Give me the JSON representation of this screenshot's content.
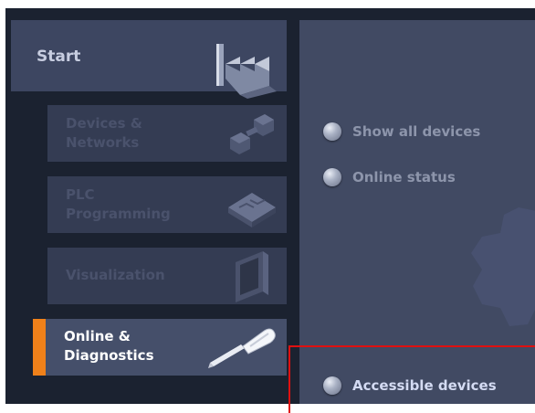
{
  "nav": {
    "start": {
      "label": "Start",
      "icon": "factory-icon"
    },
    "items": [
      {
        "label": "Devices &\nNetworks",
        "icon": "devices-networks-icon",
        "enabled": false
      },
      {
        "label": "PLC\nProgramming",
        "icon": "plc-programming-icon",
        "enabled": false
      },
      {
        "label": "Visualization",
        "icon": "hmi-panel-icon",
        "enabled": false
      },
      {
        "label": "Online &\nDiagnostics",
        "icon": "screwdriver-icon",
        "enabled": true,
        "selected": true
      }
    ]
  },
  "panel": {
    "actions": [
      {
        "label": "Show all devices",
        "icon": "bullet-icon"
      },
      {
        "label": "Online status",
        "icon": "bullet-icon"
      },
      {
        "label": "Accessible devices",
        "icon": "bullet-icon",
        "highlighted": true
      }
    ]
  },
  "colors": {
    "accent": "#f0811a",
    "highlight_box": "#e01010",
    "background": "#1b2230",
    "panel": "#414a63"
  }
}
